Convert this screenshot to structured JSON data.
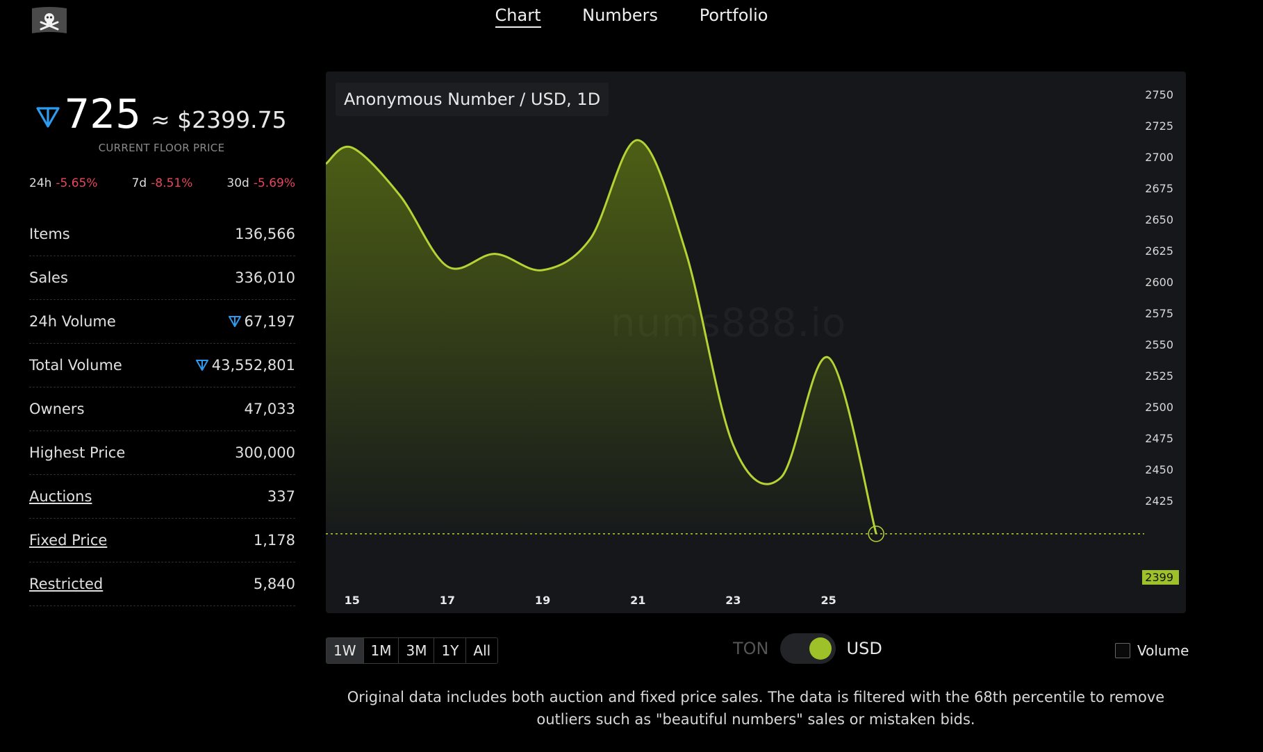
{
  "nav": {
    "tabs": [
      {
        "label": "Chart"
      },
      {
        "label": "Numbers"
      },
      {
        "label": "Portfolio"
      }
    ],
    "active": "Chart"
  },
  "floor": {
    "ton_value": "725",
    "usd_value": "≈ $2399.75",
    "caption": "CURRENT FLOOR PRICE"
  },
  "changes": [
    {
      "period": "24h",
      "value": "-5.65%"
    },
    {
      "period": "7d",
      "value": "-8.51%"
    },
    {
      "period": "30d",
      "value": "-5.69%"
    }
  ],
  "stats": [
    {
      "label": "Items",
      "value": "136,566"
    },
    {
      "label": "Sales",
      "value": "336,010"
    },
    {
      "label": "24h Volume",
      "value": "67,197"
    },
    {
      "label": "Total Volume",
      "value": "43,552,801"
    },
    {
      "label": "Owners",
      "value": "47,033"
    },
    {
      "label": "Highest Price",
      "value": "300,000"
    },
    {
      "label": "Auctions",
      "value": "337"
    },
    {
      "label": "Fixed Price",
      "value": "1,178"
    },
    {
      "label": "Restricted",
      "value": "5,840"
    }
  ],
  "chart": {
    "title": "Anonymous Number / USD, 1D",
    "watermark": "nums888.io",
    "current_price_label": "2399"
  },
  "chart_data": {
    "type": "area",
    "title": "Anonymous Number / USD, 1D",
    "x_ticks": [
      "15",
      "17",
      "19",
      "21",
      "23",
      "25"
    ],
    "y_ticks": [
      2750,
      2725,
      2700,
      2675,
      2650,
      2625,
      2600,
      2575,
      2550,
      2525,
      2500,
      2475,
      2450,
      2425
    ],
    "ylim": [
      2399,
      2750
    ],
    "xlim": [
      14.45,
      32.5
    ],
    "series": [
      {
        "x": [
          14.45,
          15,
          16,
          17,
          18,
          19,
          20,
          21,
          22,
          23,
          24,
          25,
          26
        ],
        "values": [
          2695,
          2708,
          2670,
          2613,
          2623,
          2610,
          2635,
          2714,
          2625,
          2470,
          2444,
          2540,
          2399
        ]
      }
    ],
    "current_price": 2399,
    "line_color": "#b5d334"
  },
  "ranges": [
    "1W",
    "1M",
    "3M",
    "1Y",
    "All"
  ],
  "active_range": "1W",
  "currency": {
    "left": "TON",
    "right": "USD",
    "selected": "USD"
  },
  "volume": {
    "label": "Volume",
    "checked": false
  },
  "note": "Original data includes both auction and fixed price sales. The data is filtered with the 68th percentile to remove outliers such as \"beautiful numbers\" sales or mistaken bids."
}
